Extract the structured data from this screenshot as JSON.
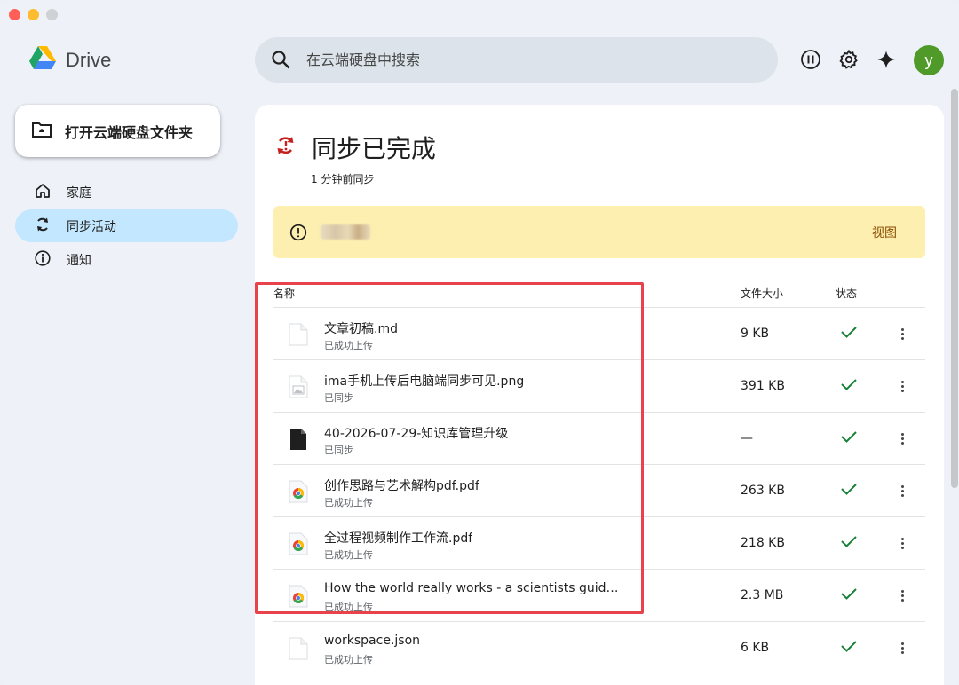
{
  "app": {
    "title": "Drive",
    "colors": {
      "accent": "#c2e7ff",
      "avatar": "#4f9a28",
      "banner": "#fcefb0",
      "highlight": "#e8434b",
      "check": "#188038"
    }
  },
  "header": {
    "search_placeholder": "在云端硬盘中搜索",
    "icons": [
      "pause-icon",
      "gear-icon",
      "sparkle-icon"
    ],
    "avatar_letter": "y"
  },
  "sidebar": {
    "open_button_label": "打开云端硬盘文件夹",
    "items": [
      {
        "label": "家庭",
        "icon": "home-icon",
        "active": false
      },
      {
        "label": "同步活动",
        "icon": "sync-icon",
        "active": true
      },
      {
        "label": "通知",
        "icon": "info-icon",
        "active": false
      }
    ]
  },
  "main": {
    "title": "同步已完成",
    "subtitle": "1 分钟前同步",
    "banner": {
      "view_label": "视图"
    },
    "columns": {
      "name": "名称",
      "size": "文件大小",
      "status": "状态"
    },
    "files": [
      {
        "name": "文章初稿.md",
        "status": "已成功上传",
        "size": "9 KB",
        "icon": "file-icon"
      },
      {
        "name": "ima手机上传后电脑端同步可见.png",
        "status": "已同步",
        "size": "391 KB",
        "icon": "image-file-icon"
      },
      {
        "name": "40-2026-07-29-知识库管理升级",
        "status": "已同步",
        "size": "—",
        "icon": "doc-icon"
      },
      {
        "name": "创作思路与艺术解构pdf.pdf",
        "status": "已成功上传",
        "size": "263 KB",
        "icon": "chrome-pdf-icon"
      },
      {
        "name": "全过程视频制作工作流.pdf",
        "status": "已成功上传",
        "size": "218 KB",
        "icon": "chrome-pdf-icon"
      },
      {
        "name": "How the world really works - a scientists guide ...",
        "status": "已成功上传",
        "size": "2.3 MB",
        "icon": "chrome-pdf-icon"
      },
      {
        "name": "workspace.json",
        "status": "已成功上传",
        "size": "6 KB",
        "icon": "file-icon"
      }
    ]
  }
}
